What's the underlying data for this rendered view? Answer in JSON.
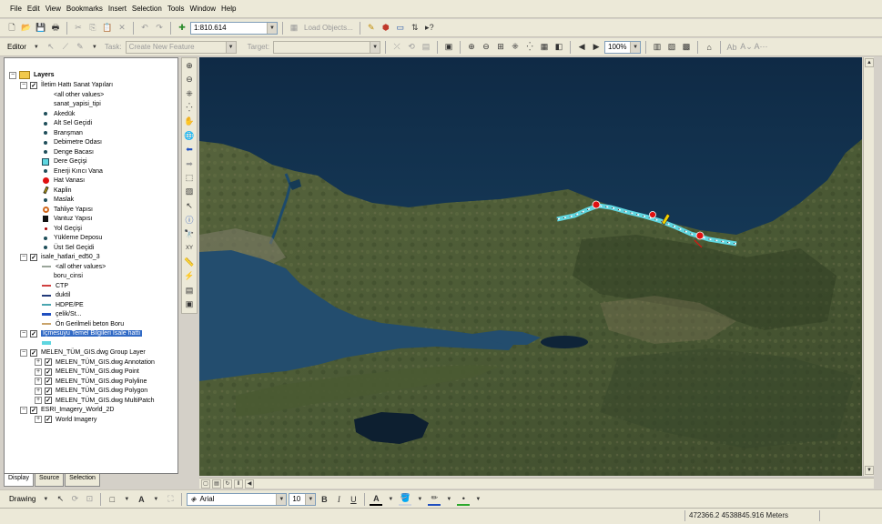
{
  "menu": [
    "File",
    "Edit",
    "View",
    "Bookmarks",
    "Insert",
    "Selection",
    "Tools",
    "Window",
    "Help"
  ],
  "standard_toolbar": {
    "scale": "1:810.614",
    "load_objects": "Load Objects..."
  },
  "editor_toolbar": {
    "editor_label": "Editor",
    "task_label": "Task:",
    "task_value": "Create New Feature",
    "target_label": "Target:",
    "target_value": "",
    "zoom_value": "100%"
  },
  "toc": {
    "root": "Layers",
    "rows": [
      {
        "label": "İletim Hattı Sanat Yapıları",
        "indent": 1,
        "type": "layer"
      },
      {
        "label": "<all other values>",
        "indent": 3,
        "type": "value",
        "sym": "none"
      },
      {
        "label": "sanat_yapisi_tipi",
        "indent": 3,
        "type": "value",
        "sym": "none"
      },
      {
        "label": "Akedük",
        "indent": 3,
        "type": "value",
        "sym": "dot"
      },
      {
        "label": "Alt Sel Geçidi",
        "indent": 3,
        "type": "value",
        "sym": "dot"
      },
      {
        "label": "Branşman",
        "indent": 3,
        "type": "value",
        "sym": "dot"
      },
      {
        "label": "Debimetre Odası",
        "indent": 3,
        "type": "value",
        "sym": "dot"
      },
      {
        "label": "Denge Bacası",
        "indent": 3,
        "type": "value",
        "sym": "dot"
      },
      {
        "label": "Dere Geçişi",
        "indent": 3,
        "type": "value",
        "sym": "teal-box"
      },
      {
        "label": "Enerji Kırıcı Vana",
        "indent": 3,
        "type": "value",
        "sym": "dot"
      },
      {
        "label": "Hat Vanası",
        "indent": 3,
        "type": "value",
        "sym": "red-circle"
      },
      {
        "label": "Kaplin",
        "indent": 3,
        "type": "value",
        "sym": "yellow-slash"
      },
      {
        "label": "Maslak",
        "indent": 3,
        "type": "value",
        "sym": "dot"
      },
      {
        "label": "Tahliye Yapısı",
        "indent": 3,
        "type": "value",
        "sym": "orange-ring"
      },
      {
        "label": "Vantuz Yapısı",
        "indent": 3,
        "type": "value",
        "sym": "black-box"
      },
      {
        "label": "Yol Geçişi",
        "indent": 3,
        "type": "value",
        "sym": "red-dot"
      },
      {
        "label": "Yükleme Deposu",
        "indent": 3,
        "type": "value",
        "sym": "dot"
      },
      {
        "label": "Üst Sel Geçidi",
        "indent": 3,
        "type": "value",
        "sym": "dot"
      },
      {
        "label": "isale_hatlari_ed50_3",
        "indent": 1,
        "type": "layer"
      },
      {
        "label": "<all other values>",
        "indent": 3,
        "type": "value",
        "sym": "line-gray"
      },
      {
        "label": "boru_cinsi",
        "indent": 3,
        "type": "value",
        "sym": "none"
      },
      {
        "label": "CTP",
        "indent": 3,
        "type": "value",
        "sym": "line-red"
      },
      {
        "label": "duktil",
        "indent": 3,
        "type": "value",
        "sym": "line-navy"
      },
      {
        "label": "HDPE/PE",
        "indent": 3,
        "type": "value",
        "sym": "line-teal"
      },
      {
        "label": "çelik/St...",
        "indent": 3,
        "type": "value",
        "sym": "line-blue-thick"
      },
      {
        "label": "Ön Gerilmeli beton Boru",
        "indent": 3,
        "type": "value",
        "sym": "line-tan"
      },
      {
        "label": "İçmesuyu Temel Bilgileri İsale hattı",
        "indent": 1,
        "type": "layer-selected"
      },
      {
        "label": "",
        "indent": 3,
        "type": "value",
        "sym": "teal-swatch"
      },
      {
        "label": "MELEN_TÜM_GIS.dwg Group Layer",
        "indent": 1,
        "type": "layer"
      },
      {
        "label": "MELEN_TÜM_GIS.dwg Annotation",
        "indent": 2,
        "type": "sublayer"
      },
      {
        "label": "MELEN_TÜM_GIS.dwg Point",
        "indent": 2,
        "type": "sublayer"
      },
      {
        "label": "MELEN_TÜM_GIS.dwg Polyline",
        "indent": 2,
        "type": "sublayer"
      },
      {
        "label": "MELEN_TÜM_GIS.dwg Polygon",
        "indent": 2,
        "type": "sublayer"
      },
      {
        "label": "MELEN_TÜM_GIS.dwg MultiPatch",
        "indent": 2,
        "type": "sublayer"
      },
      {
        "label": "ESRI_Imagery_World_2D",
        "indent": 1,
        "type": "layer"
      },
      {
        "label": "World Imagery",
        "indent": 2,
        "type": "sublayer"
      }
    ],
    "tabs": [
      "Display",
      "Source",
      "Selection"
    ]
  },
  "drawing_toolbar": {
    "drawing_label": "Drawing",
    "font": "Arial",
    "font_size": "10",
    "bold": "B",
    "italic": "I",
    "underline": "U",
    "text_tool": "A"
  },
  "status": {
    "coordinates": "472366.2  4538845.916 Meters"
  },
  "colors": {
    "water": "#173a56",
    "land": "#4f5e3a",
    "pipeline_teal": "#5fd6e0",
    "valve_red": "#e01010",
    "selection_blue": "#316ac5"
  }
}
